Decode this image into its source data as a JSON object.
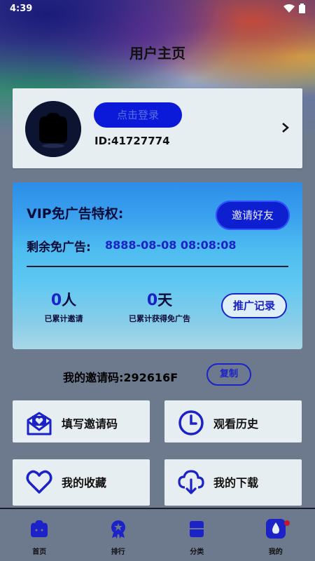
{
  "status_bar": {
    "time": "4:39"
  },
  "header": {
    "title": "用户主页"
  },
  "user_card": {
    "login_label": "点击登录",
    "user_id": "ID:41727774"
  },
  "vip": {
    "title": "VIP免广告特权:",
    "invite_friends_label": "邀请好友",
    "remaining_label": "剩余免广告:",
    "remaining_value": "8888-08-08 08:08:08",
    "invited_count": "0",
    "invited_unit": "人",
    "invited_label": "已累计邀请",
    "days_count": "0",
    "days_unit": "天",
    "days_label": "已累计获得免广告",
    "records_label": "推广记录"
  },
  "invite_code": {
    "text": "我的邀请码:292616F",
    "copy_label": "复制"
  },
  "tiles": [
    {
      "label": "填写邀请码",
      "icon": "mail-heart-icon"
    },
    {
      "label": "观看历史",
      "icon": "clock-icon"
    },
    {
      "label": "我的收藏",
      "icon": "heart-icon"
    },
    {
      "label": "我的下载",
      "icon": "cloud-download-icon"
    }
  ],
  "nav": [
    {
      "label": "首页",
      "icon": "home-icon"
    },
    {
      "label": "排行",
      "icon": "ranking-medal-icon"
    },
    {
      "label": "分类",
      "icon": "category-icon"
    },
    {
      "label": "我的",
      "icon": "profile-icon"
    }
  ],
  "colors": {
    "accent": "#1a22c8",
    "login_button": "#0a1ad8",
    "card_bg": "#e7eef2",
    "notification_dot": "#c01830"
  }
}
